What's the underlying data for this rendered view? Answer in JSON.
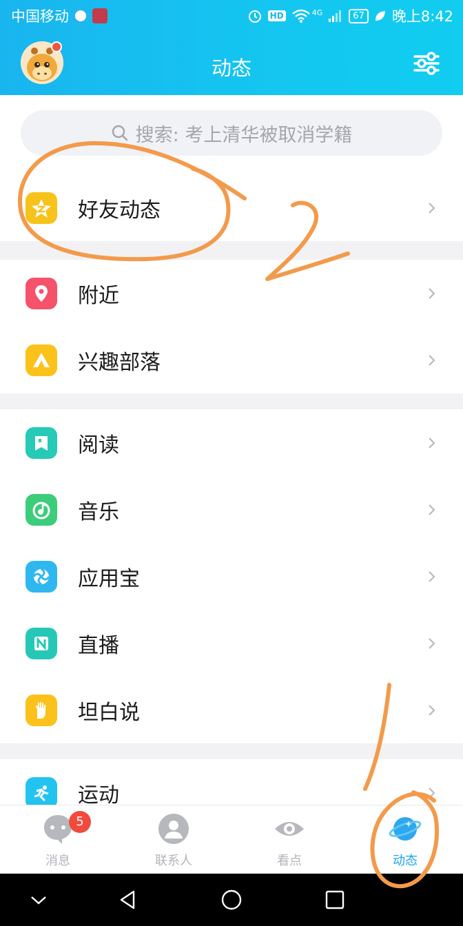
{
  "status_bar": {
    "carrier": "中国移动",
    "net": "4G",
    "battery": "67",
    "time": "晚上8:42",
    "hd": "HD"
  },
  "header": {
    "title": "动态"
  },
  "search": {
    "placeholder": "搜索: 考上清华被取消学籍"
  },
  "groups": [
    {
      "items": [
        {
          "label": "好友动态",
          "icon": "qzone-star-icon",
          "color": "#f7c21a"
        }
      ]
    },
    {
      "items": [
        {
          "label": "附近",
          "icon": "location-pin-icon",
          "color": "#f5526b"
        },
        {
          "label": "兴趣部落",
          "icon": "tent-icon",
          "color": "#fbc21b"
        }
      ]
    },
    {
      "items": [
        {
          "label": "阅读",
          "icon": "book-icon",
          "color": "#27c9b7"
        },
        {
          "label": "音乐",
          "icon": "music-note-icon",
          "color": "#3ccd7a"
        },
        {
          "label": "应用宝",
          "icon": "app-store-icon",
          "color": "#2fb8f0"
        },
        {
          "label": "直播",
          "icon": "live-n-icon",
          "color": "#25c8b6"
        },
        {
          "label": "坦白说",
          "icon": "hand-icon",
          "color": "#fbc21b"
        }
      ]
    },
    {
      "items": [
        {
          "label": "运动",
          "icon": "running-icon",
          "color": "#22c3f0"
        }
      ]
    }
  ],
  "tabs": [
    {
      "label": "消息",
      "icon": "chat-bubble-icon",
      "badge": "5",
      "active": false
    },
    {
      "label": "联系人",
      "icon": "contact-person-icon",
      "active": false
    },
    {
      "label": "看点",
      "icon": "eye-icon",
      "active": false
    },
    {
      "label": "动态",
      "icon": "planet-icon",
      "active": true
    }
  ],
  "annotations": [
    "1",
    "2"
  ],
  "colors": {
    "header_start": "#19b5ef",
    "header_end": "#11cdf0",
    "annotation": "#f39a4b",
    "active_tab": "#1aa3ec"
  }
}
